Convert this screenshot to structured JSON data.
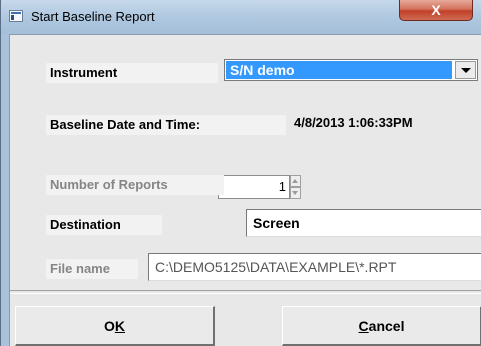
{
  "window": {
    "title": "Start Baseline Report",
    "close_glyph": "X",
    "icon": "app-window-icon"
  },
  "form": {
    "instrument_label": "Instrument",
    "instrument_value": "S/N demo",
    "baseline_label": "Baseline Date and Time:",
    "baseline_value": "4/8/2013 1:06:33PM",
    "reports_count": "1",
    "reports_label": "Number of Reports",
    "destination_label": "Destination",
    "destination_value": "Screen",
    "filename_label": "File name",
    "filename_value": "C:\\DEMO5125\\DATA\\EXAMPLE\\*.RPT"
  },
  "buttons": {
    "ok_pre": "O",
    "ok_accel": "K",
    "cancel_accel": "C",
    "cancel_post": "ancel"
  },
  "colors": {
    "selection": "#3399ff",
    "close_button": "#c7452e",
    "titlebar": "#b1c9e1"
  }
}
